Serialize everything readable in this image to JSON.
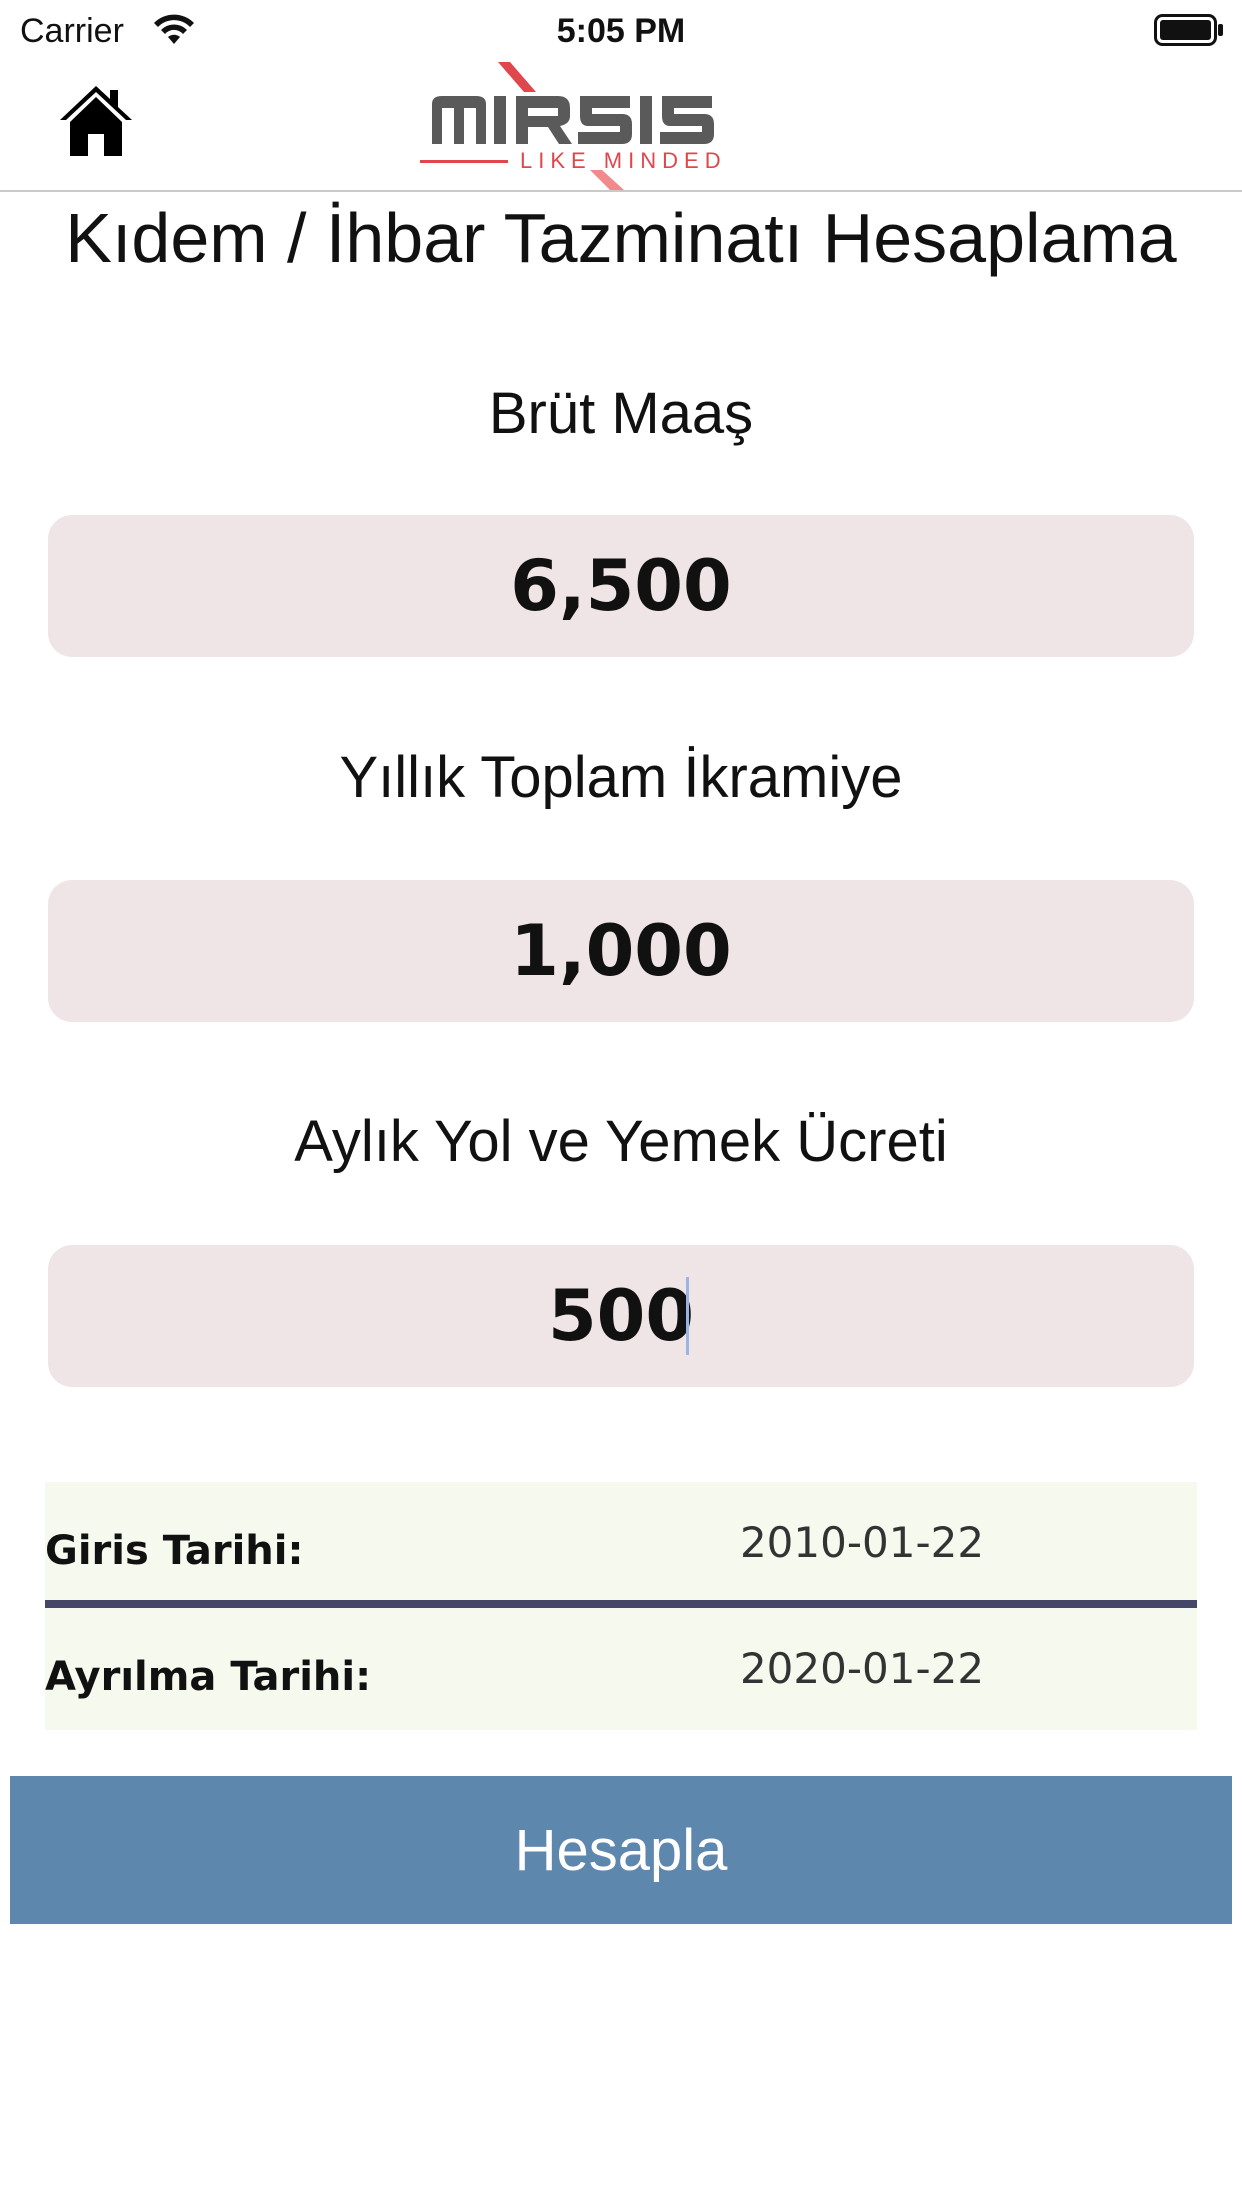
{
  "status_bar": {
    "carrier": "Carrier",
    "time": "5:05 PM"
  },
  "nav": {
    "home_icon": "home-icon",
    "logo": {
      "brand": "mirsis",
      "tagline": "LIKE MINDED",
      "colors": {
        "text": "#5a5a5a",
        "accent": "#e0474c"
      }
    }
  },
  "page": {
    "title": "Kıdem / İhbar Tazminatı Hesaplama"
  },
  "fields": [
    {
      "label": "Brüt Maaş",
      "value": "6,500"
    },
    {
      "label": "Yıllık Toplam İkramiye",
      "value": "1,000"
    },
    {
      "label": "Aylık Yol ve Yemek Ücreti",
      "value": "500"
    }
  ],
  "dates": {
    "start_label": "Giris Tarihi:",
    "start_value": "2010-01-22",
    "end_label": "Ayrılma Tarihi:",
    "end_value": "2020-01-22"
  },
  "actions": {
    "calculate_label": "Hesapla"
  },
  "colors": {
    "input_bg": "#efe5e6",
    "date_bg": "#f5f9ee",
    "divider": "#454769",
    "button_bg": "#5e87ae"
  }
}
